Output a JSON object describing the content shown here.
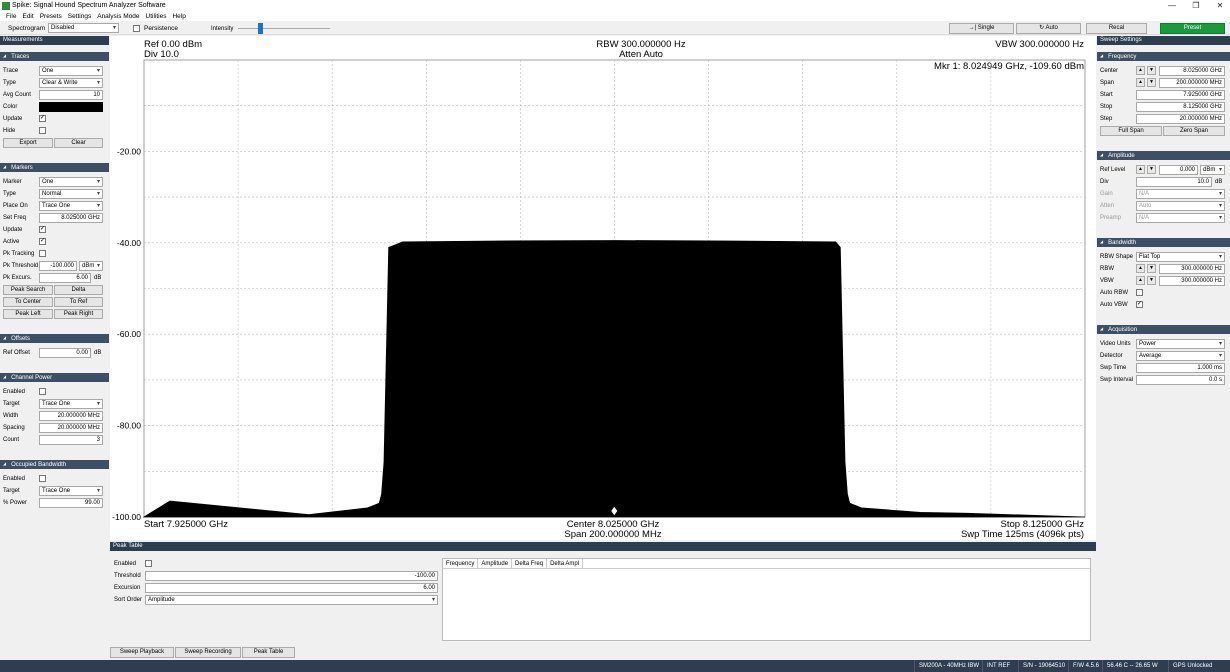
{
  "window": {
    "title": "Spike: Signal Hound Spectrum Analyzer Software"
  },
  "menu": [
    "File",
    "Edit",
    "Presets",
    "Settings",
    "Analysis Mode",
    "Utilities",
    "Help"
  ],
  "toolbar": {
    "spectrogram_label": "Spectrogram",
    "spectrogram_value": "Disabled",
    "persistence_label": "Persistence",
    "intensity_label": "Intensity",
    "single": "Single",
    "auto": "Auto",
    "recal": "Recal",
    "preset": "Preset"
  },
  "left": {
    "header": "Measurements",
    "traces": {
      "title": "Traces",
      "trace_label": "Trace",
      "trace": "One",
      "type_label": "Type",
      "type": "Clear & Write",
      "avg_label": "Avg Count",
      "avg": "10",
      "color_label": "Color",
      "update_label": "Update",
      "hide_label": "Hide",
      "export": "Export",
      "clear": "Clear"
    },
    "markers": {
      "title": "Markers",
      "marker_label": "Marker",
      "marker": "One",
      "type_label": "Type",
      "type": "Normal",
      "place_label": "Place On",
      "place": "Trace One",
      "setfreq_label": "Set Freq",
      "setfreq": "8.025000 GHz",
      "update_label": "Update",
      "active_label": "Active",
      "pktrack_label": "Pk Tracking",
      "pkthresh_label": "Pk Threshold",
      "pkthresh": "-100.000",
      "pkthresh_unit": "dBm",
      "pkexc_label": "Pk Excurs.",
      "pkexc": "6.00",
      "pkexc_unit": "dB",
      "peak_search": "Peak Search",
      "delta": "Delta",
      "to_center": "To Center",
      "to_ref": "To Ref",
      "peak_left": "Peak Left",
      "peak_right": "Peak Right"
    },
    "offsets": {
      "title": "Offsets",
      "ref_label": "Ref Offset",
      "ref": "0.00",
      "ref_unit": "dB"
    },
    "channel": {
      "title": "Channel Power",
      "enabled_label": "Enabled",
      "target_label": "Target",
      "target": "Trace One",
      "width_label": "Width",
      "width": "20.000000 MHz",
      "spacing_label": "Spacing",
      "spacing": "20.000000 MHz",
      "count_label": "Count",
      "count": "3"
    },
    "occupied": {
      "title": "Occupied Bandwidth",
      "enabled_label": "Enabled",
      "target_label": "Target",
      "target": "Trace One",
      "power_label": "% Power",
      "power": "99.00"
    }
  },
  "right": {
    "header": "Sweep Settings",
    "frequency": {
      "title": "Frequency",
      "center_label": "Center",
      "center": "8.025000 GHz",
      "span_label": "Span",
      "span": "200.000000 MHz",
      "start_label": "Start",
      "start": "7.925000 GHz",
      "stop_label": "Stop",
      "stop": "8.125000 GHz",
      "step_label": "Step",
      "step": "20.000000 MHz",
      "full_span": "Full Span",
      "zero_span": "Zero Span"
    },
    "amplitude": {
      "title": "Amplitude",
      "ref_label": "Ref Level",
      "ref": "0.000",
      "ref_unit": "dBm",
      "div_label": "Div",
      "div": "10.0",
      "div_unit": "dB",
      "gain_label": "Gain",
      "gain": "N/A",
      "atten_label": "Atten",
      "atten": "Auto",
      "preamp_label": "Preamp",
      "preamp": "N/A"
    },
    "bandwidth": {
      "title": "Bandwidth",
      "shape_label": "RBW Shape",
      "shape": "Flat Top",
      "rbw_label": "RBW",
      "rbw": "300.000000 Hz",
      "vbw_label": "VBW",
      "vbw": "300.000000 Hz",
      "autorbw_label": "Auto RBW",
      "autovbw_label": "Auto VBW"
    },
    "acquisition": {
      "title": "Acquisition",
      "units_label": "Video Units",
      "units": "Power",
      "detector_label": "Detector",
      "detector": "Average",
      "swptime_label": "Swp Time",
      "swptime": "1.000 ms",
      "swpint_label": "Swp Interval",
      "swpint": "0.0 s"
    }
  },
  "chart": {
    "ref": "Ref 0.00 dBm",
    "div": "Div 10.0",
    "rbw": "RBW 300.000000 Hz",
    "atten": "Atten Auto",
    "vbw": "VBW 300.000000 Hz",
    "marker": "Mkr 1: 8.024949 GHz, -109.60 dBm",
    "start": "Start 7.925000 GHz",
    "center": "Center 8.025000 GHz",
    "span": "Span 200.000000 MHz",
    "stop": "Stop 8.125000 GHz",
    "swp": "Swp Time 125ms (4096k pts)"
  },
  "chart_data": {
    "type": "area",
    "x_unit": "GHz",
    "y_unit": "dBm",
    "xlim": [
      7.925,
      8.125
    ],
    "ylim": [
      -100,
      0
    ],
    "grid": true,
    "yticks": [
      "-20.00",
      "-40.00",
      "-60.00",
      "-80.00",
      "-100.00"
    ],
    "x": [
      7.925,
      7.9305,
      7.96,
      7.9725,
      7.975,
      7.9755,
      7.976,
      7.977,
      7.98,
      8.0,
      8.025,
      8.05,
      8.072,
      8.073,
      8.074,
      8.0745,
      8.075,
      8.0775,
      8.09,
      8.1,
      8.125
    ],
    "y": [
      -100,
      -96.5,
      -99.5,
      -98,
      -97,
      -95,
      -88,
      -41,
      -39.8,
      -39.6,
      -39.5,
      -39.6,
      -39.8,
      -41,
      -88,
      -95,
      -97,
      -98,
      -99,
      -99.2,
      -100
    ],
    "marker": {
      "x": 8.024949,
      "y": -109.6
    }
  },
  "peak_table": {
    "title": "Peak Table",
    "enabled_label": "Enabled",
    "threshold_label": "Threshold",
    "threshold": "-100.00",
    "excursion_label": "Excursion",
    "excursion": "6.00",
    "sort_label": "Sort Order",
    "sort": "Amplitude",
    "cols": [
      "Frequency",
      "Amplitude",
      "Delta Freq",
      "Delta Ampl"
    ]
  },
  "bottom": {
    "playback": "Sweep Playback",
    "recording": "Sweep Recording",
    "peak_table": "Peak Table"
  },
  "status": [
    "SM200A - 40MHz IBW",
    "INT REF",
    "S/N - 19064510",
    "F/W 4.5.6",
    "56.46 C -- 26.65 W",
    "GPS Unlocked"
  ]
}
